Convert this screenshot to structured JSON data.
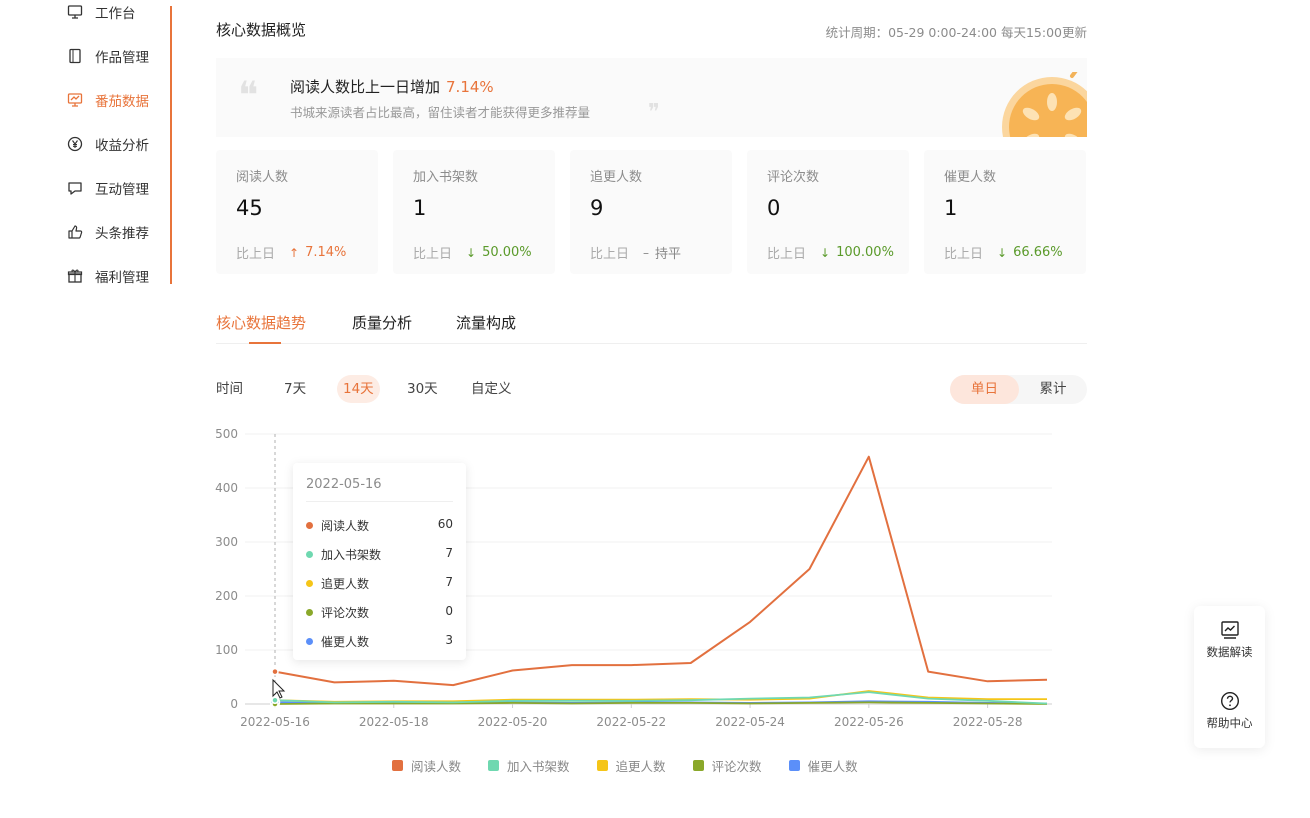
{
  "sidebar": {
    "items": [
      {
        "label": "工作台",
        "icon": "monitor-icon"
      },
      {
        "label": "作品管理",
        "icon": "book-icon"
      },
      {
        "label": "番茄数据",
        "icon": "chart-screen-icon"
      },
      {
        "label": "收益分析",
        "icon": "yen-icon"
      },
      {
        "label": "互动管理",
        "icon": "chat-icon"
      },
      {
        "label": "头条推荐",
        "icon": "thumb-up-icon"
      },
      {
        "label": "福利管理",
        "icon": "gift-icon"
      }
    ],
    "active_index": 2
  },
  "header": {
    "title": "核心数据概览",
    "period": "统计周期：05-29 0:00-24:00 每天15:00更新"
  },
  "banner": {
    "headline": "阅读人数比上一日增加",
    "headline_pct": "7.14%",
    "subline": "书城来源读者占比最高，留住读者才能获得更多推荐量"
  },
  "cards": [
    {
      "label": "阅读人数",
      "value": "45",
      "cmp_label": "比上日",
      "trend": "up",
      "arrow": "↑",
      "change": "7.14%"
    },
    {
      "label": "加入书架数",
      "value": "1",
      "cmp_label": "比上日",
      "trend": "down",
      "arrow": "↓",
      "change": "50.00%"
    },
    {
      "label": "追更人数",
      "value": "9",
      "cmp_label": "比上日",
      "trend": "flat",
      "arrow": "–",
      "change": "持平"
    },
    {
      "label": "评论次数",
      "value": "0",
      "cmp_label": "比上日",
      "trend": "down",
      "arrow": "↓",
      "change": "100.00%"
    },
    {
      "label": "催更人数",
      "value": "1",
      "cmp_label": "比上日",
      "trend": "down",
      "arrow": "↓",
      "change": "66.66%"
    }
  ],
  "tabs": [
    "核心数据趋势",
    "质量分析",
    "流量构成"
  ],
  "filters": {
    "label": "时间",
    "options": [
      "7天",
      "14天",
      "30天",
      "自定义"
    ],
    "active": "14天"
  },
  "mode": {
    "options": [
      "单日",
      "累计"
    ],
    "active": "单日"
  },
  "tooltip": {
    "date": "2022-05-16",
    "rows": [
      {
        "name": "阅读人数",
        "value": "60"
      },
      {
        "name": "加入书架数",
        "value": "7"
      },
      {
        "name": "追更人数",
        "value": "7"
      },
      {
        "name": "评论次数",
        "value": "0"
      },
      {
        "name": "催更人数",
        "value": "3"
      }
    ]
  },
  "floating": {
    "data_label": "数据解读",
    "help_label": "帮助中心"
  },
  "chart_data": {
    "type": "line",
    "x": [
      "2022-05-16",
      "2022-05-17",
      "2022-05-18",
      "2022-05-19",
      "2022-05-20",
      "2022-05-21",
      "2022-05-22",
      "2022-05-23",
      "2022-05-24",
      "2022-05-25",
      "2022-05-26",
      "2022-05-27",
      "2022-05-28",
      "2022-05-29"
    ],
    "x_tick_labels": [
      "2022-05-16",
      "2022-05-18",
      "2022-05-20",
      "2022-05-22",
      "2022-05-24",
      "2022-05-26",
      "2022-05-28"
    ],
    "ylim": [
      0,
      500
    ],
    "y_ticks": [
      0,
      100,
      200,
      300,
      400,
      500
    ],
    "grid": true,
    "legend": "bottom",
    "series": [
      {
        "name": "阅读人数",
        "color": "#e2703f",
        "values": [
          60,
          40,
          43,
          35,
          62,
          72,
          72,
          76,
          152,
          250,
          458,
          60,
          42,
          45
        ]
      },
      {
        "name": "加入书架数",
        "color": "#6fd8b0",
        "values": [
          7,
          3,
          4,
          3,
          6,
          6,
          6,
          7,
          10,
          12,
          22,
          10,
          6,
          1
        ]
      },
      {
        "name": "追更人数",
        "color": "#f5c518",
        "values": [
          7,
          4,
          5,
          5,
          8,
          8,
          8,
          9,
          8,
          10,
          24,
          12,
          9,
          9
        ]
      },
      {
        "name": "评论次数",
        "color": "#8aa82a",
        "values": [
          0,
          1,
          1,
          1,
          2,
          1,
          2,
          2,
          1,
          2,
          3,
          2,
          1,
          0
        ]
      },
      {
        "name": "催更人数",
        "color": "#5b8ff9",
        "values": [
          3,
          2,
          2,
          2,
          3,
          2,
          3,
          3,
          2,
          3,
          5,
          4,
          2,
          1
        ]
      }
    ]
  }
}
